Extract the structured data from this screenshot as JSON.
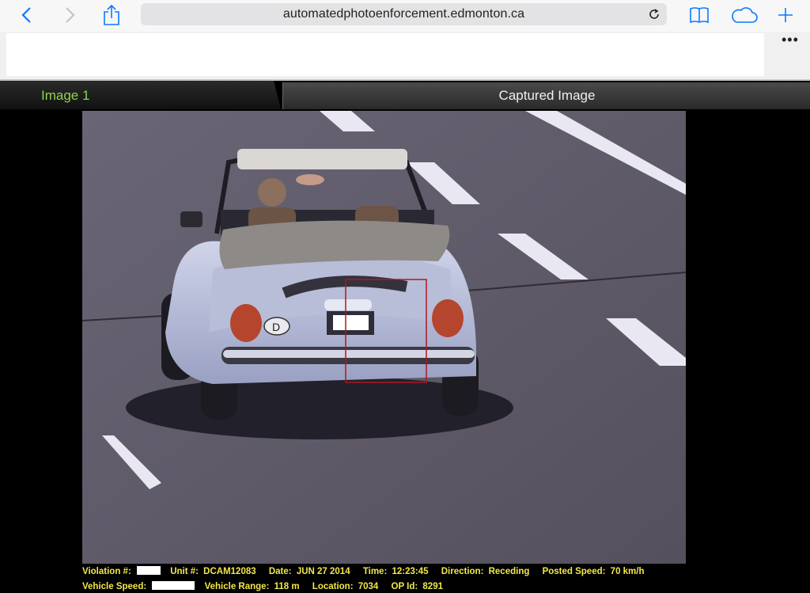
{
  "browser": {
    "url": "automatedphotoenforcement.edmonton.ca",
    "icons": [
      "back-icon",
      "forward-icon",
      "share-icon",
      "reload-icon",
      "bookmarks-icon",
      "cloud-tabs-icon",
      "new-tab-icon",
      "more-icon"
    ],
    "more_label": "•••",
    "accent_color": "#0a7aff"
  },
  "tabs": [
    {
      "label": "Image 1",
      "color": "#8ed24a"
    },
    {
      "label": "Captured Image"
    }
  ],
  "photo": {
    "description_alt": "",
    "detection_box_color": "#b0171f"
  },
  "info": {
    "line1": [
      {
        "label": "Violation #:",
        "value": null,
        "redacted": true
      },
      {
        "label": "Unit #:",
        "value": "DCAM12083"
      },
      {
        "label": "Date:",
        "value": "JUN 27 2014"
      },
      {
        "label": "Time:",
        "value": "12:23:45"
      },
      {
        "label": "Direction:",
        "value": "Receding"
      },
      {
        "label": "Posted Speed:",
        "value": "70 km/h"
      }
    ],
    "line2": [
      {
        "label": "Vehicle Speed:",
        "value": null,
        "redacted": true
      },
      {
        "label": "Vehicle Range:",
        "value": "118 m"
      },
      {
        "label": "Location:",
        "value": "7034"
      },
      {
        "label": "OP Id:",
        "value": "8291"
      }
    ],
    "text_color": "#f2e84a"
  }
}
